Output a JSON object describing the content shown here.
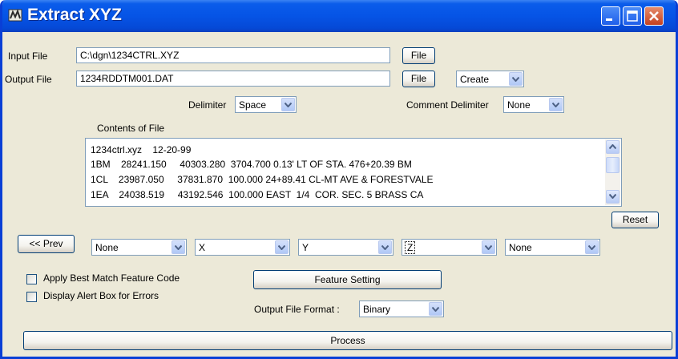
{
  "window": {
    "title": "Extract XYZ",
    "controls": {
      "minimize": "minimize",
      "maximize": "maximize",
      "close": "close"
    }
  },
  "input_file": {
    "label": "Input File",
    "value": "C:\\dgn\\1234CTRL.XYZ",
    "button": "File"
  },
  "output_file": {
    "label": "Output File",
    "value": "1234RDDTM001.DAT",
    "button": "File",
    "mode": "Create"
  },
  "delimiter": {
    "label": "Delimiter",
    "value": "Space"
  },
  "comment_delimiter": {
    "label": "Comment Delimiter",
    "value": "None"
  },
  "contents": {
    "label": "Contents of File",
    "lines": [
      "1234ctrl.xyz    12-20-99",
      "1BM    28241.150     40303.280  3704.700 0.13' LT OF STA. 476+20.39 BM",
      "1CL    23987.050     37831.870  100.000 24+89.41 CL-MT AVE & FORESTVALE",
      "1EA    24038.519     43192.546  100.000 EAST  1/4  COR. SEC. 5 BRASS CA"
    ]
  },
  "reset_button": "Reset",
  "prev_button": "<< Prev",
  "columns": [
    "None",
    "X",
    "Y",
    "Z",
    "None"
  ],
  "options": {
    "best_match": "Apply Best Match Feature Code",
    "alert_box": "Display Alert Box for Errors"
  },
  "feature_setting_button": "Feature Setting",
  "output_format": {
    "label": "Output File Format :",
    "value": "Binary"
  },
  "process_button": "Process",
  "colors": {
    "titlebar": "#0654e6",
    "window_bg": "#ece9d8",
    "close": "#c5401e"
  }
}
